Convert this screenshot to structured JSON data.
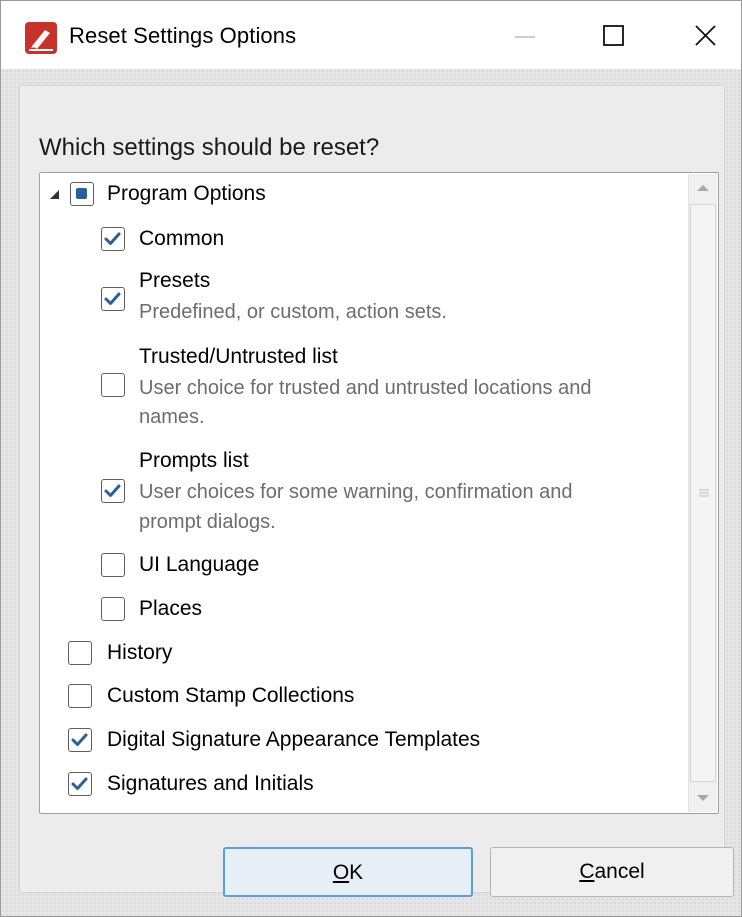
{
  "window": {
    "title": "Reset Settings Options"
  },
  "dialog": {
    "question": "Which settings should be reset?",
    "tree": {
      "program_options": {
        "label": "Program Options",
        "expanded": true,
        "state": "indeterminate"
      },
      "children": [
        {
          "label": "Common",
          "checked": true,
          "description": ""
        },
        {
          "label": "Presets",
          "checked": true,
          "description": "Predefined, or custom, action sets."
        },
        {
          "label": "Trusted/Untrusted list",
          "checked": false,
          "description_1": "User choice for trusted and untrusted locations and",
          "description_2": "names."
        },
        {
          "label": "Prompts list",
          "checked": true,
          "description_1": "User choices for some warning, confirmation and",
          "description_2": "prompt dialogs."
        },
        {
          "label": "UI Language",
          "checked": false
        },
        {
          "label": "Places",
          "checked": false
        }
      ],
      "top_level": [
        {
          "label": "History",
          "checked": false
        },
        {
          "label": "Custom Stamp Collections",
          "checked": false
        },
        {
          "label": "Digital Signature Appearance Templates",
          "checked": true
        },
        {
          "label": "Signatures and Initials",
          "checked": true
        }
      ]
    },
    "buttons": {
      "ok_prefix": "",
      "ok_underlined": "O",
      "ok_rest": "K",
      "cancel_underlined": "C",
      "cancel_rest": "ancel"
    }
  },
  "icons": {
    "app": "app-pdf-icon",
    "minimize": "minimize-icon",
    "maximize": "maximize-icon",
    "close": "close-icon",
    "expander": "triangle-expanded-icon",
    "checkmark": "checkmark-icon"
  },
  "colors": {
    "accent": "#2a5f9e",
    "app_icon": "#c8322c",
    "ok_border": "#5a9fd6"
  }
}
